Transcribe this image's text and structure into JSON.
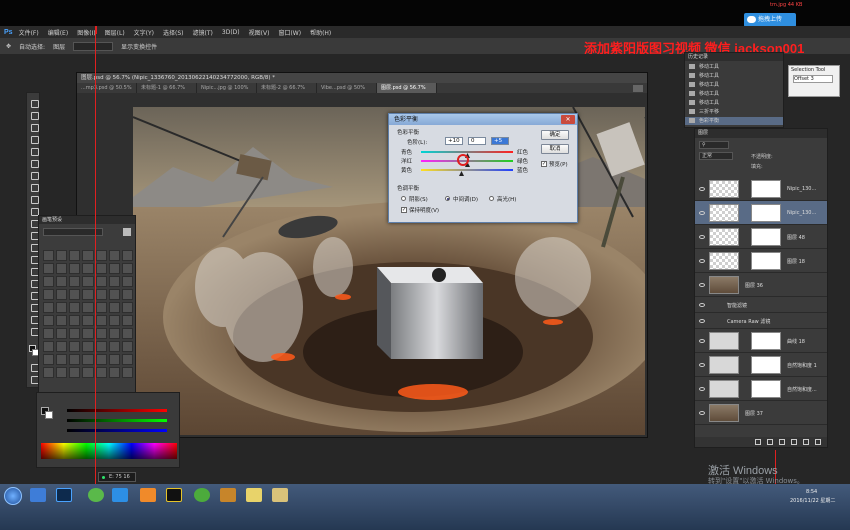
{
  "top_bar": {
    "upload_button": "拖拽上传",
    "dl_label": "tm.jpg 44 KB"
  },
  "menubar": {
    "logo": "Ps",
    "items": [
      "文件(F)",
      "编辑(E)",
      "图像(I)",
      "图层(L)",
      "文字(Y)",
      "选择(S)",
      "滤镜(T)",
      "3D(D)",
      "视图(V)",
      "窗口(W)",
      "帮助(H)"
    ]
  },
  "options_bar": {
    "auto_select": "自动选择:",
    "target": "图层",
    "show_transform": "显示变换控件"
  },
  "watermark": "添加紫阳版图习视频 微信 jackson001",
  "document": {
    "title": "图层.psd @ 56.7% (Nipic_1336760_20130622140234772000, RGB/8) *",
    "tabs": [
      "...mp3.psd @ 50.5%",
      "未标题-1 @ 66.7%",
      "Nipic...jpg @ 100%",
      "未标题-2 @ 66.7%",
      "Vibe...psd @ 50%",
      "图层.psd @ 56.7%"
    ]
  },
  "color_balance": {
    "title": "色彩平衡",
    "section_balance": "色彩平衡",
    "levels_label": "色阶(L):",
    "levels": [
      "+10",
      "0",
      "+5"
    ],
    "sliders": [
      {
        "left": "青色",
        "right": "红色",
        "value": 10
      },
      {
        "left": "洋红",
        "right": "绿色",
        "value": 0
      },
      {
        "left": "黄色",
        "right": "蓝色",
        "value": 5
      }
    ],
    "section_tone": "色调平衡",
    "tones": [
      "阴影(S)",
      "中间调(D)",
      "高光(H)"
    ],
    "tone_selected": "中间调(D)",
    "preserve_luminosity": "保持明度(V)",
    "ok": "确定",
    "cancel": "取消",
    "preview": "预览(P)"
  },
  "swatch_panel": {
    "title": "画笔预设"
  },
  "history_panel": {
    "title": "历史记录",
    "items": [
      "移动工具",
      "移动工具",
      "移动工具",
      "移动工具",
      "移动工具",
      "三折平移",
      "色彩平衡"
    ]
  },
  "small_window": {
    "title": "Selection Tool",
    "value": "Offset 3"
  },
  "layers_panel": {
    "title": "图层",
    "mode": "正常",
    "opacity_label": "不透明度:",
    "fill_label": "填充:",
    "layers": [
      {
        "name": "Nipic_130...",
        "thumb": "chk"
      },
      {
        "name": "Nipic_130...",
        "thumb": "chk",
        "selected": true
      },
      {
        "name": "图层 48",
        "thumb": "chk"
      },
      {
        "name": "图层 18",
        "thumb": "chk"
      },
      {
        "name": "图层 36",
        "thumb": "img"
      },
      {
        "name": "智能滤镜",
        "thumb": "none"
      },
      {
        "name": "Camera Raw 滤镜",
        "thumb": "none"
      },
      {
        "name": "曲线 18",
        "thumb": "white"
      },
      {
        "name": "自然饱和度 1",
        "thumb": "white"
      },
      {
        "name": "自然饱和度...",
        "thumb": "white"
      },
      {
        "name": "图层 37",
        "thumb": "img"
      }
    ]
  },
  "cursor_tip": "E: 75 16",
  "windows_activate": {
    "line1": "激活 Windows",
    "line2": "转到\"设置\"以激活 Windows。"
  },
  "taskbar": {
    "time": "8:54",
    "date": "2016/11/22 星期二"
  },
  "colors": {
    "ps_blue": "#4aa3ff",
    "watermark_red": "#ff1e1e",
    "dialog_bg": "#d7dbe2",
    "layer_selected": "#596b86"
  }
}
